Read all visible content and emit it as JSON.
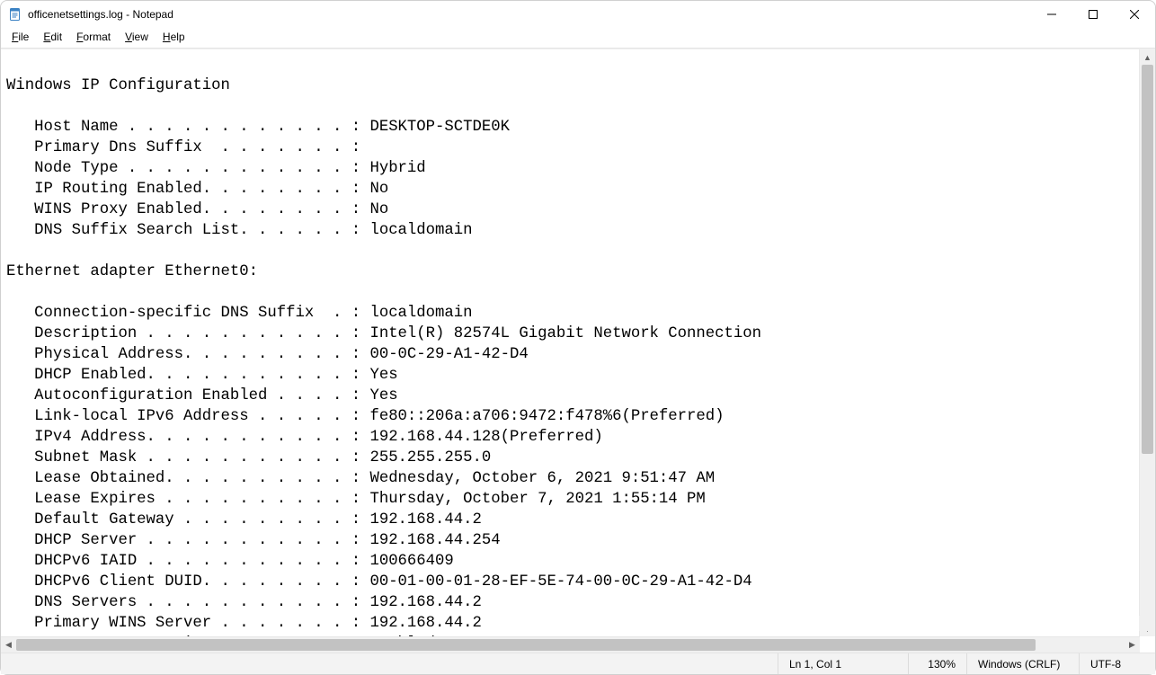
{
  "window": {
    "title": "officenetsettings.log - Notepad"
  },
  "menu": {
    "file": "File",
    "edit": "Edit",
    "format": "Format",
    "view": "View",
    "help": "Help"
  },
  "document_text": "\nWindows IP Configuration\n\n   Host Name . . . . . . . . . . . . : DESKTOP-SCTDE0K\n   Primary Dns Suffix  . . . . . . . :\n   Node Type . . . . . . . . . . . . : Hybrid\n   IP Routing Enabled. . . . . . . . : No\n   WINS Proxy Enabled. . . . . . . . : No\n   DNS Suffix Search List. . . . . . : localdomain\n\nEthernet adapter Ethernet0:\n\n   Connection-specific DNS Suffix  . : localdomain\n   Description . . . . . . . . . . . : Intel(R) 82574L Gigabit Network Connection\n   Physical Address. . . . . . . . . : 00-0C-29-A1-42-D4\n   DHCP Enabled. . . . . . . . . . . : Yes\n   Autoconfiguration Enabled . . . . : Yes\n   Link-local IPv6 Address . . . . . : fe80::206a:a706:9472:f478%6(Preferred)\n   IPv4 Address. . . . . . . . . . . : 192.168.44.128(Preferred)\n   Subnet Mask . . . . . . . . . . . : 255.255.255.0\n   Lease Obtained. . . . . . . . . . : Wednesday, October 6, 2021 9:51:47 AM\n   Lease Expires . . . . . . . . . . : Thursday, October 7, 2021 1:55:14 PM\n   Default Gateway . . . . . . . . . : 192.168.44.2\n   DHCP Server . . . . . . . . . . . : 192.168.44.254\n   DHCPv6 IAID . . . . . . . . . . . : 100666409\n   DHCPv6 Client DUID. . . . . . . . : 00-01-00-01-28-EF-5E-74-00-0C-29-A1-42-D4\n   DNS Servers . . . . . . . . . . . : 192.168.44.2\n   Primary WINS Server . . . . . . . : 192.168.44.2\n   NetBIOS over Tcpip. . . . . . . . : Enabled",
  "status": {
    "position": "Ln 1, Col 1",
    "zoom": "130%",
    "line_ending": "Windows (CRLF)",
    "encoding": "UTF-8"
  }
}
